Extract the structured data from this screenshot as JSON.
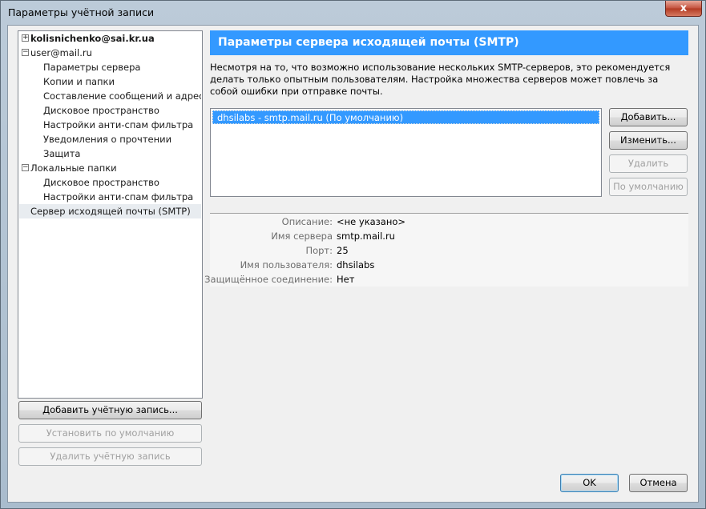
{
  "window": {
    "title": "Параметры учётной записи",
    "close_glyph": "x"
  },
  "tree": {
    "items": [
      {
        "label": "kolisnichenko@sai.kr.ua",
        "expander": "+"
      },
      {
        "label": "user@mail.ru",
        "expander": "−"
      },
      {
        "label": "Параметры сервера"
      },
      {
        "label": "Копии и папки"
      },
      {
        "label": "Составление сообщений и адреса..."
      },
      {
        "label": "Дисковое пространство"
      },
      {
        "label": "Настройки анти-спам фильтра"
      },
      {
        "label": "Уведомления о прочтении"
      },
      {
        "label": "Защита"
      },
      {
        "label": "Локальные папки",
        "expander": "−"
      },
      {
        "label": "Дисковое пространство"
      },
      {
        "label": "Настройки анти-спам фильтра"
      },
      {
        "label": "Сервер исходящей почты (SMTP)"
      }
    ]
  },
  "left_buttons": {
    "add_account": "Добавить учётную запись...",
    "set_default": "Установить по умолчанию",
    "delete_account": "Удалить учётную запись"
  },
  "panel": {
    "heading": "Параметры сервера исходящей почты (SMTP)",
    "description": "Несмотря на то, что возможно использование нескольких SMTP-серверов, это рекомендуется делать только опытным пользователям. Настройка множества серверов может повлечь за собой ошибки при отправке почты.",
    "servers": [
      "dhsilabs - smtp.mail.ru (По умолчанию)"
    ],
    "buttons": {
      "add": "Добавить...",
      "edit": "Изменить...",
      "delete": "Удалить",
      "default": "По умолчанию"
    },
    "details": {
      "description_label": "Описание:",
      "description_value": "<не указано>",
      "server_label": "Имя сервера",
      "server_value": "smtp.mail.ru",
      "port_label": "Порт:",
      "port_value": "25",
      "user_label": "Имя пользователя:",
      "user_value": "dhsilabs",
      "secure_label": "Защищённое соединение:",
      "secure_value": "Нет"
    }
  },
  "footer": {
    "ok": "OK",
    "cancel": "Отмена"
  },
  "colors": {
    "accent": "#3399ff"
  }
}
